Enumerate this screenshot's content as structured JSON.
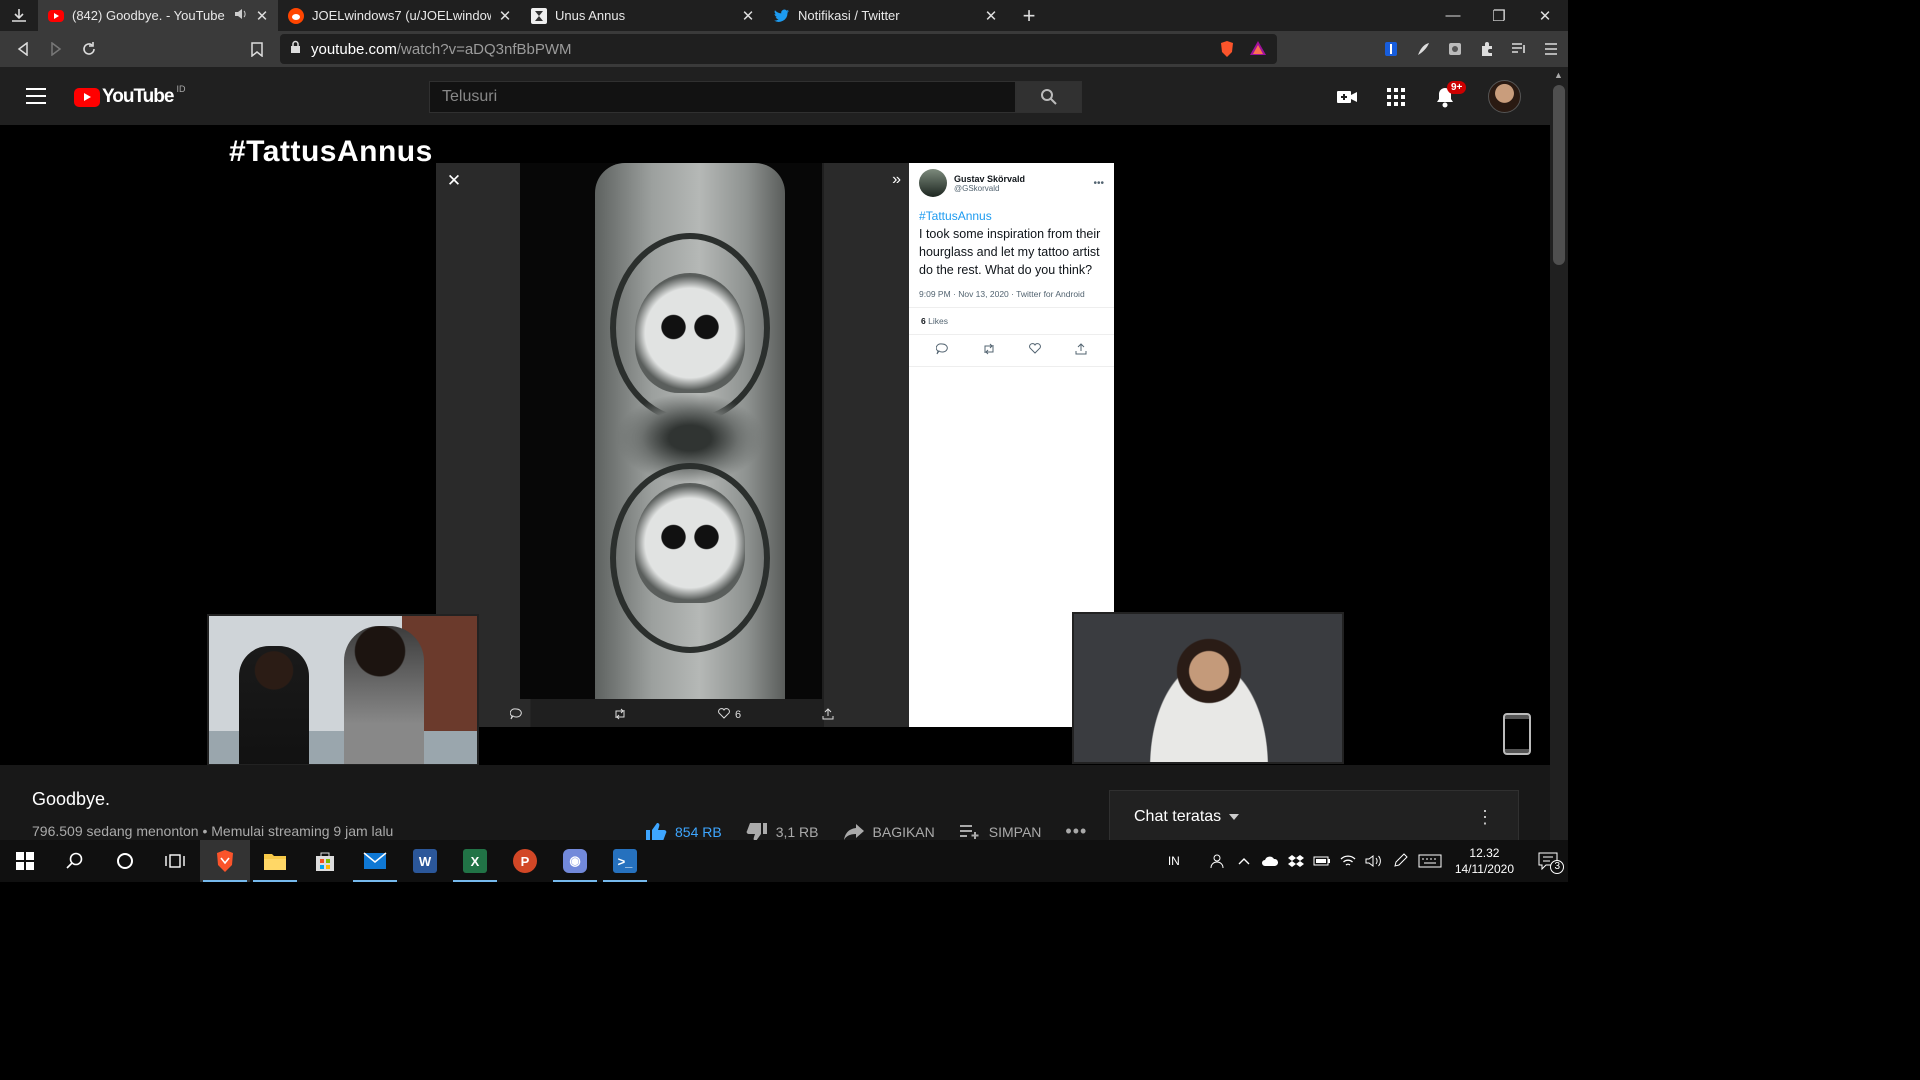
{
  "browser": {
    "tabs": [
      {
        "title": "(842) Goodbye. - YouTube",
        "favicon": "youtube-favicon",
        "active": true,
        "muted_icon": "speaker-icon"
      },
      {
        "title": "JOELwindows7 (u/JOELwindows7)",
        "favicon": "reddit-favicon",
        "active": false
      },
      {
        "title": "Unus Annus",
        "favicon": "unus-annus-favicon",
        "active": false
      },
      {
        "title": "Notifikasi / Twitter",
        "favicon": "twitter-favicon",
        "active": false
      }
    ],
    "url_host": "youtube.com",
    "url_path": "/watch?v=aDQ3nfBbPWM"
  },
  "youtube": {
    "region": "ID",
    "search_placeholder": "Telusuri",
    "notification_count": "9+"
  },
  "video": {
    "overlay_title": "#TattusAnnus",
    "tweet": {
      "name": "Gustav Skörvald",
      "handle": "@GSkorvald",
      "hashtag": "#TattusAnnus",
      "body": "I took some inspiration from their hourglass and let my tattoo artist do the rest. What do you think?",
      "meta": "9:09 PM · Nov 13, 2020 · Twitter for Android",
      "likes_count": "6",
      "likes_label": "Likes"
    },
    "screen_like_count": "6"
  },
  "below": {
    "title": "Goodbye.",
    "meta": "796.509 sedang menonton • Memulai streaming 9 jam lalu",
    "likes": "854 RB",
    "dislikes": "3,1 RB",
    "share": "BAGIKAN",
    "save": "SIMPAN",
    "chat_label": "Chat teratas"
  },
  "taskbar": {
    "language": "IN",
    "time": "12.32",
    "date": "14/11/2020",
    "notifications": "3"
  },
  "colors": {
    "youtube_red": "#ff0000",
    "like_blue": "#3ea6ff",
    "twitter_blue": "#1d9bf0"
  }
}
